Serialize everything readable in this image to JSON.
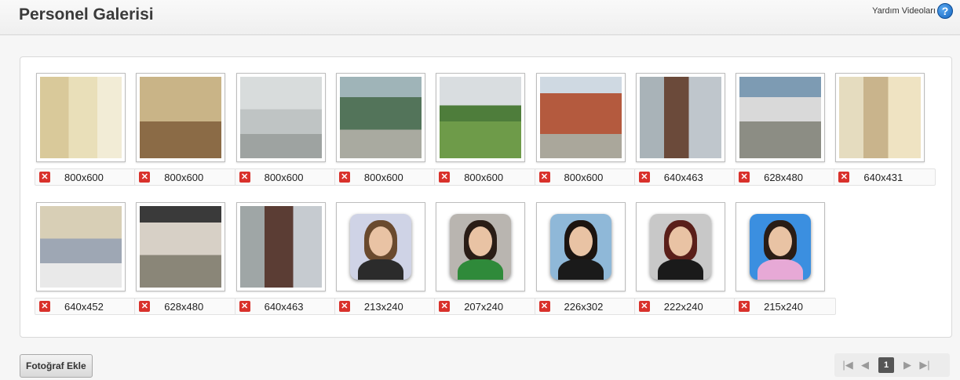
{
  "header": {
    "title": "Personel Galerisi",
    "help_label": "Yardım Videoları",
    "help_icon": "question-circle-icon"
  },
  "gallery": {
    "delete_icon": "close-x-icon",
    "photos": [
      {
        "size": "800x600",
        "kind": "office-wall"
      },
      {
        "size": "800x600",
        "kind": "office-room"
      },
      {
        "size": "800x600",
        "kind": "corridor"
      },
      {
        "size": "800x600",
        "kind": "window-view"
      },
      {
        "size": "800x600",
        "kind": "schoolyard"
      },
      {
        "size": "800x600",
        "kind": "school-building"
      },
      {
        "size": "640x463",
        "kind": "group-carpet"
      },
      {
        "size": "628x480",
        "kind": "group-outdoor"
      },
      {
        "size": "640x431",
        "kind": "group-indoor"
      },
      {
        "size": "640x452",
        "kind": "meeting-table"
      },
      {
        "size": "628x480",
        "kind": "group-outdoor-2"
      },
      {
        "size": "640x463",
        "kind": "group-carpet-2"
      },
      {
        "size": "213x240",
        "kind": "portrait",
        "hair": "#6a4a2e",
        "bg": "#cfd3e6",
        "clothes": "#2b2b2b"
      },
      {
        "size": "207x240",
        "kind": "portrait",
        "hair": "#2a1d16",
        "bg": "#b9b5b0",
        "clothes": "#2f8a3a"
      },
      {
        "size": "226x302",
        "kind": "portrait",
        "hair": "#1c1410",
        "bg": "#8fb8d8",
        "clothes": "#1a1a1a"
      },
      {
        "size": "222x240",
        "kind": "portrait",
        "hair": "#5a1f1a",
        "bg": "#c8c8c8",
        "clothes": "#1a1a1a"
      },
      {
        "size": "215x240",
        "kind": "portrait",
        "hair": "#2a1d16",
        "bg": "#3b8fe0",
        "clothes": "#e7a9d6"
      }
    ]
  },
  "footer": {
    "add_button": "Fotoğraf Ekle",
    "current_page": "1",
    "first_icon": "first-page-icon",
    "prev_icon": "prev-page-icon",
    "next_icon": "next-page-icon",
    "last_icon": "last-page-icon"
  }
}
